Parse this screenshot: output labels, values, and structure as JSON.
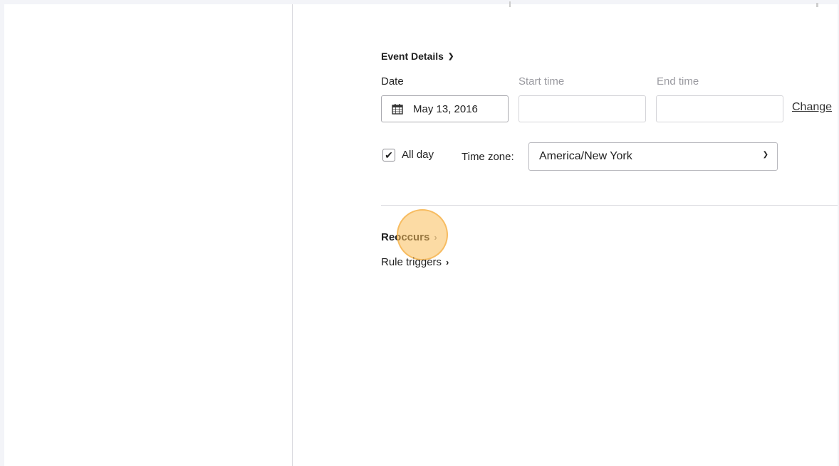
{
  "event_details": {
    "title": "Event Details",
    "date_label": "Date",
    "start_time_label": "Start time",
    "end_time_label": "End time",
    "date_value": "May 13, 2016",
    "start_time_value": "",
    "end_time_value": "",
    "change_link": "Change",
    "all_day_label": "All day",
    "all_day_checked": true,
    "timezone_label": "Time zone:",
    "timezone_value": "America/New York"
  },
  "sections": {
    "reoccurs_label": "Reoccurs",
    "rule_triggers_label": "Rule triggers"
  },
  "icons": {
    "calendar": "calendar-icon",
    "event_details_toggle": "chevron-down-icon",
    "select_caret": "chevron-down-icon",
    "reoccurs_toggle": "chevron-right-icon",
    "rule_triggers_toggle": "chevron-right-icon",
    "checkbox_check": "checkmark-icon"
  },
  "colors": {
    "highlight": "#fabe5a",
    "muted_label": "#9a9aa0",
    "border": "#d4d4d8"
  }
}
